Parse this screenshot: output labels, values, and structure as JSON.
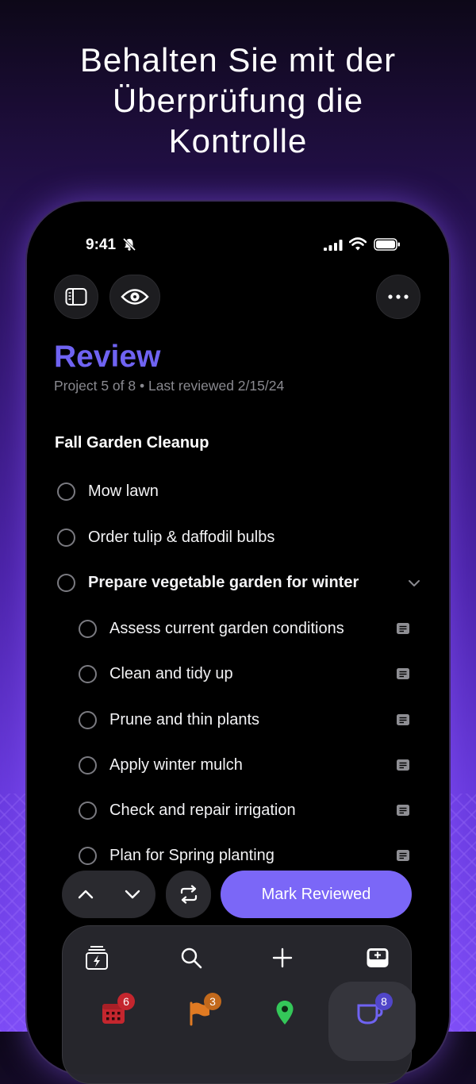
{
  "headline": [
    "Behalten Sie mit der",
    "Überprüfung die",
    "Kontrolle"
  ],
  "status_bar": {
    "time": "9:41"
  },
  "review": {
    "title": "Review",
    "subtitle": "Project 5 of 8 • Last reviewed 2/15/24",
    "project_name": "Fall Garden Cleanup",
    "tasks": [
      {
        "label": "Mow lawn"
      },
      {
        "label": "Order tulip & daffodil bulbs"
      },
      {
        "label": "Prepare vegetable garden for winter"
      }
    ],
    "subtasks": [
      {
        "label": "Assess current garden conditions"
      },
      {
        "label": "Clean and tidy up"
      },
      {
        "label": "Prune and thin plants"
      },
      {
        "label": "Apply winter mulch"
      },
      {
        "label": "Check and repair irrigation"
      },
      {
        "label": "Plan for Spring planting"
      }
    ]
  },
  "actions": {
    "mark_reviewed": "Mark Reviewed"
  },
  "tab_bar": {
    "badges": {
      "forecast": "6",
      "flagged": "3",
      "review": "8"
    }
  },
  "colors": {
    "accent": "#7b67f7",
    "title": "#6f63f2",
    "forecast_badge": "#c4262e",
    "flagged_badge": "#c2691c",
    "review_badge": "#5146c9",
    "location_icon": "#34c759"
  },
  "icons": {
    "sidebar": "sidebar-icon",
    "eye": "eye-icon",
    "more": "ellipsis-icon",
    "note": "note-icon",
    "expand": "chevron-down-icon",
    "up": "chevron-up-icon",
    "down": "chevron-down-icon",
    "repeat": "repeat-icon",
    "quick_entry": "quick-entry-icon",
    "search": "search-icon",
    "add": "plus-icon",
    "inbox": "inbox-icon",
    "forecast": "forecast-icon",
    "flagged": "flag-icon",
    "nearby": "location-pin-icon",
    "review": "review-cup-icon"
  }
}
